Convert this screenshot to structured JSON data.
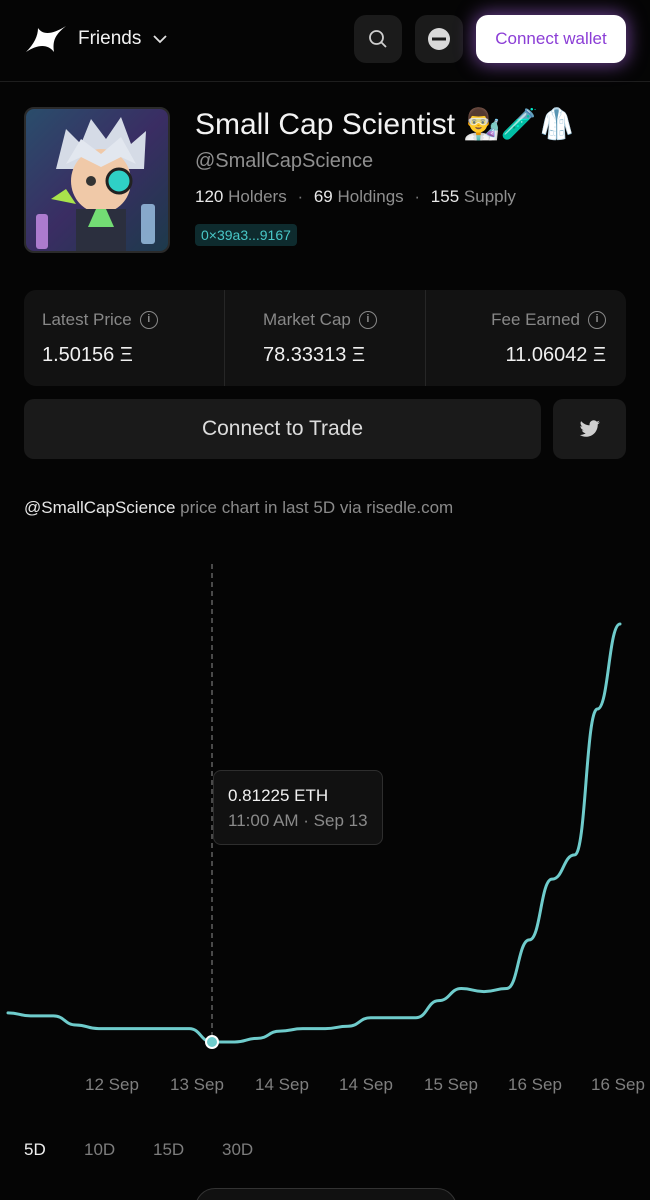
{
  "header": {
    "brand": "Friends",
    "connect_wallet_label": "Connect wallet"
  },
  "profile": {
    "name": "Small Cap Scientist 👨‍🔬🧪🥼",
    "handle": "@SmallCapScience",
    "holders_count": "120",
    "holders_label": "Holders",
    "holdings_count": "69",
    "holdings_label": "Holdings",
    "supply_count": "155",
    "supply_label": "Supply",
    "address": "0×39a3...9167"
  },
  "metrics": [
    {
      "label": "Latest Price",
      "value": "1.50156 Ξ"
    },
    {
      "label": "Market Cap",
      "value": "78.33313 Ξ"
    },
    {
      "label": "Fee Earned",
      "value": "11.06042 Ξ"
    }
  ],
  "trade": {
    "connect_label": "Connect to Trade"
  },
  "chart_caption": {
    "handle": "@SmallCapScience",
    "text": " price chart in last 5D via risedle.com"
  },
  "tooltip": {
    "value": "0.81225 ETH",
    "time": "11:00 AM · Sep 13"
  },
  "ranges": [
    "5D",
    "10D",
    "15D",
    "30D"
  ],
  "colors": {
    "line": "#6fcccc",
    "accent": "#8b3dd6",
    "background": "#050505"
  },
  "chart_data": {
    "type": "line",
    "x_tick_labels": [
      "12 Sep",
      "13 Sep",
      "14 Sep",
      "14 Sep",
      "15 Sep",
      "16 Sep",
      "16 Sep"
    ],
    "series": [
      {
        "values": [
          0.86,
          0.855,
          0.855,
          0.84,
          0.834,
          0.834,
          0.834,
          0.834,
          0.834,
          0.812,
          0.812,
          0.818,
          0.83,
          0.834,
          0.834,
          0.838,
          0.852,
          0.852,
          0.852,
          0.88,
          0.9,
          0.895,
          0.9,
          0.98,
          1.08,
          1.12,
          1.36,
          1.5
        ]
      }
    ],
    "highlight": {
      "index": 9,
      "value": 0.81225,
      "time": "11:00 AM · Sep 13"
    },
    "grid": false,
    "legend": "none"
  }
}
